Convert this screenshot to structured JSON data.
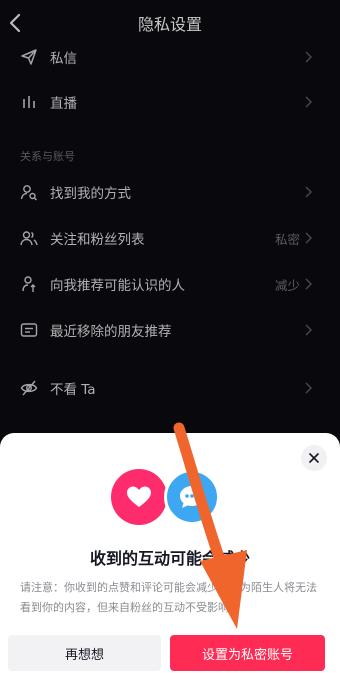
{
  "header": {
    "title": "隐私设置"
  },
  "rows": {
    "messages": {
      "label": "私信"
    },
    "live": {
      "label": "直播"
    },
    "find_me": {
      "label": "找到我的方式"
    },
    "follow_list": {
      "label": "关注和粉丝列表",
      "value": "私密"
    },
    "recommend": {
      "label": "向我推荐可能认识的人",
      "value": "减少"
    },
    "removed": {
      "label": "最近移除的朋友推荐"
    },
    "hide": {
      "label": "不看 Ta"
    }
  },
  "section": {
    "relations_label": "关系与账号"
  },
  "dialog": {
    "title": "收到的互动可能会减少",
    "description": "请注意：你收到的点赞和评论可能会减少，因为陌生人将无法看到你的内容，但来自粉丝的互动不受影响。",
    "cancel_label": "再想想",
    "confirm_label": "设置为私密账号"
  },
  "colors": {
    "accent": "#fe2c55",
    "heart": "#fe2c6d",
    "chat": "#3ea7f2",
    "arrow": "#f0652c"
  }
}
